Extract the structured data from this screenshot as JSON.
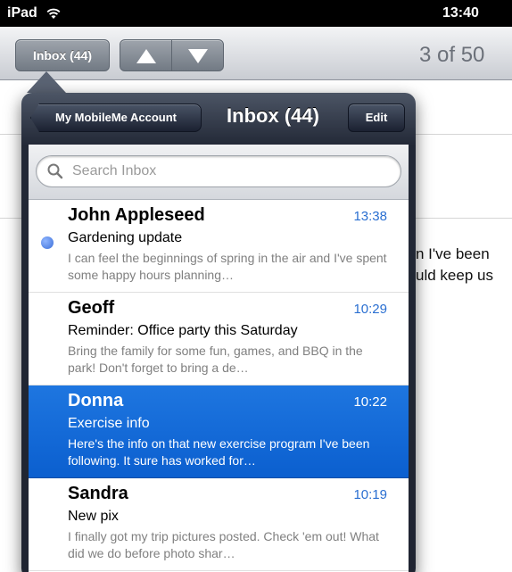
{
  "status_bar": {
    "device": "iPad",
    "time": "13:40"
  },
  "toolbar": {
    "inbox_button": "Inbox (44)",
    "page_counter": "3 of 50"
  },
  "message_fragment": {
    "line1": "n I've been",
    "line2": "uld keep us"
  },
  "popover": {
    "account_button": "My MobileMe Account",
    "title": "Inbox (44)",
    "edit_button": "Edit",
    "search_placeholder": "Search Inbox",
    "messages": [
      {
        "sender": "John Appleseed",
        "time": "13:38",
        "subject": "Gardening update",
        "preview": "I can feel the beginnings of spring in the air and I've spent some happy hours planning…",
        "unread": true,
        "selected": false
      },
      {
        "sender": "Geoff",
        "time": "10:29",
        "subject": "Reminder: Office party this Saturday",
        "preview": "Bring the family for some fun, games, and BBQ in the park! Don't forget to bring a de…",
        "unread": false,
        "selected": false
      },
      {
        "sender": "Donna",
        "time": "10:22",
        "subject": "Exercise info",
        "preview": "Here's the info on that new exercise program I've been following. It sure has worked for…",
        "unread": false,
        "selected": true
      },
      {
        "sender": "Sandra",
        "time": "10:19",
        "subject": "New pix",
        "preview": "I finally got my trip pictures posted. Check 'em out! What did we do before photo shar…",
        "unread": false,
        "selected": false
      }
    ]
  },
  "colors": {
    "selection_blue": "#1465d6",
    "time_blue": "#2a6fd1",
    "unread_dot": "#3c6fd8",
    "popover_frame": "#222836"
  }
}
